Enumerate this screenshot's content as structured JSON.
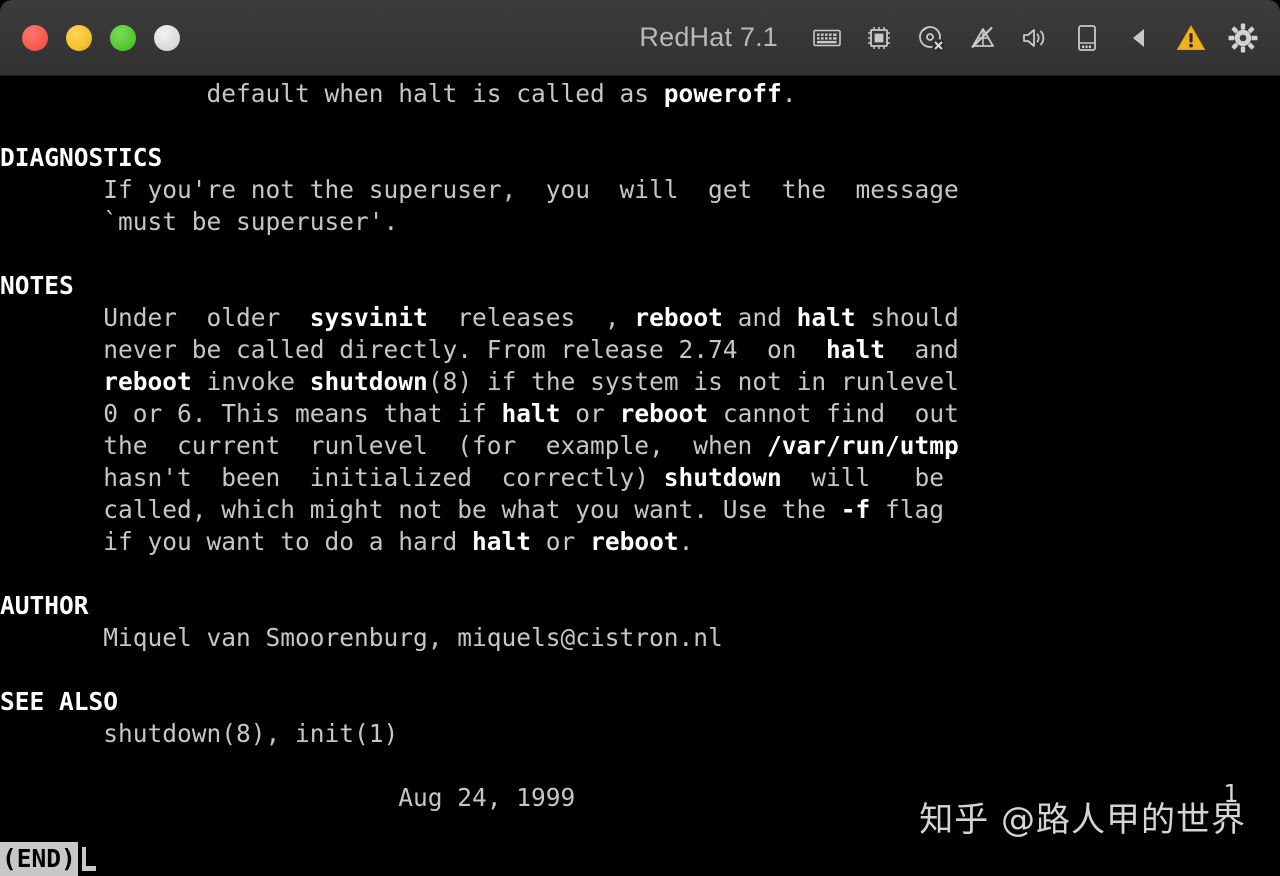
{
  "window": {
    "title": "RedHat 7.1",
    "buttons": [
      {
        "name": "close-button",
        "color": "#f85a50"
      },
      {
        "name": "minimize-button",
        "color": "#f5c32c"
      },
      {
        "name": "maximize-button",
        "color": "#52c832"
      },
      {
        "name": "fullscreen-button",
        "color": "#dcdcdc"
      }
    ],
    "status_icons": [
      {
        "name": "keyboard-icon",
        "label": "Keyboard"
      },
      {
        "name": "cpu-icon",
        "label": "Processor"
      },
      {
        "name": "optical-disc-disconnected-icon",
        "label": "CD/DVD (disconnected)"
      },
      {
        "name": "network-disconnected-icon",
        "label": "Network (disconnected)"
      },
      {
        "name": "speaker-icon",
        "label": "Sound"
      },
      {
        "name": "usb-device-icon",
        "label": "USB Device"
      },
      {
        "name": "collapse-left-icon",
        "label": "Collapse"
      },
      {
        "name": "warning-triangle-icon",
        "label": "Warning"
      },
      {
        "name": "gear-icon",
        "label": "Settings"
      }
    ]
  },
  "terminal": {
    "pager_status": "(END)",
    "page_number": "1",
    "watermark": "知乎 @路人甲的世界",
    "lines": [
      {
        "indent": 14,
        "segments": [
          {
            "text": "default when halt is called as ",
            "bold": false
          },
          {
            "text": "poweroff",
            "bold": true
          },
          {
            "text": ".",
            "bold": false
          }
        ]
      },
      {
        "indent": 0,
        "segments": []
      },
      {
        "indent": 0,
        "segments": [
          {
            "text": "DIAGNOSTICS",
            "bold": true
          }
        ]
      },
      {
        "indent": 7,
        "segments": [
          {
            "text": "If you're not the superuser,  you  will  get  the  message",
            "bold": false
          }
        ]
      },
      {
        "indent": 7,
        "segments": [
          {
            "text": "`must be superuser'.",
            "bold": false
          }
        ]
      },
      {
        "indent": 0,
        "segments": []
      },
      {
        "indent": 0,
        "segments": [
          {
            "text": "NOTES",
            "bold": true
          }
        ]
      },
      {
        "indent": 7,
        "segments": [
          {
            "text": "Under  older  ",
            "bold": false
          },
          {
            "text": "sysvinit",
            "bold": true
          },
          {
            "text": "  releases  , ",
            "bold": false
          },
          {
            "text": "reboot",
            "bold": true
          },
          {
            "text": " and ",
            "bold": false
          },
          {
            "text": "halt",
            "bold": true
          },
          {
            "text": " should",
            "bold": false
          }
        ]
      },
      {
        "indent": 7,
        "segments": [
          {
            "text": "never be called directly. From release 2.74  on  ",
            "bold": false
          },
          {
            "text": "halt",
            "bold": true
          },
          {
            "text": "  and",
            "bold": false
          }
        ]
      },
      {
        "indent": 7,
        "segments": [
          {
            "text": "reboot",
            "bold": true
          },
          {
            "text": " invoke ",
            "bold": false
          },
          {
            "text": "shutdown",
            "bold": true
          },
          {
            "text": "(8) if the system is not in runlevel",
            "bold": false
          }
        ]
      },
      {
        "indent": 7,
        "segments": [
          {
            "text": "0 or 6. This means that if ",
            "bold": false
          },
          {
            "text": "halt",
            "bold": true
          },
          {
            "text": " or ",
            "bold": false
          },
          {
            "text": "reboot",
            "bold": true
          },
          {
            "text": " cannot find  out",
            "bold": false
          }
        ]
      },
      {
        "indent": 7,
        "segments": [
          {
            "text": "the  current  runlevel  (for  example,  when ",
            "bold": false
          },
          {
            "text": "/var/run/utmp",
            "bold": true
          }
        ]
      },
      {
        "indent": 7,
        "segments": [
          {
            "text": "hasn't  been  initialized  correctly) ",
            "bold": false
          },
          {
            "text": "shutdown",
            "bold": true
          },
          {
            "text": "  will   be",
            "bold": false
          }
        ]
      },
      {
        "indent": 7,
        "segments": [
          {
            "text": "called, which might not be what you want. Use the ",
            "bold": false
          },
          {
            "text": "-f",
            "bold": true
          },
          {
            "text": " flag",
            "bold": false
          }
        ]
      },
      {
        "indent": 7,
        "segments": [
          {
            "text": "if you want to do a hard ",
            "bold": false
          },
          {
            "text": "halt",
            "bold": true
          },
          {
            "text": " or ",
            "bold": false
          },
          {
            "text": "reboot",
            "bold": true
          },
          {
            "text": ".",
            "bold": false
          }
        ]
      },
      {
        "indent": 0,
        "segments": []
      },
      {
        "indent": 0,
        "segments": [
          {
            "text": "AUTHOR",
            "bold": true
          }
        ]
      },
      {
        "indent": 7,
        "segments": [
          {
            "text": "Miquel van Smoorenburg, miquels@cistron.nl",
            "bold": false
          }
        ]
      },
      {
        "indent": 0,
        "segments": []
      },
      {
        "indent": 0,
        "segments": [
          {
            "text": "SEE ALSO",
            "bold": true
          }
        ]
      },
      {
        "indent": 7,
        "segments": [
          {
            "text": "shutdown(8), init(1)",
            "bold": false
          }
        ]
      },
      {
        "indent": 0,
        "segments": []
      },
      {
        "indent": 27,
        "segments": [
          {
            "text": "Aug 24, 1999",
            "bold": false
          }
        ]
      }
    ]
  }
}
